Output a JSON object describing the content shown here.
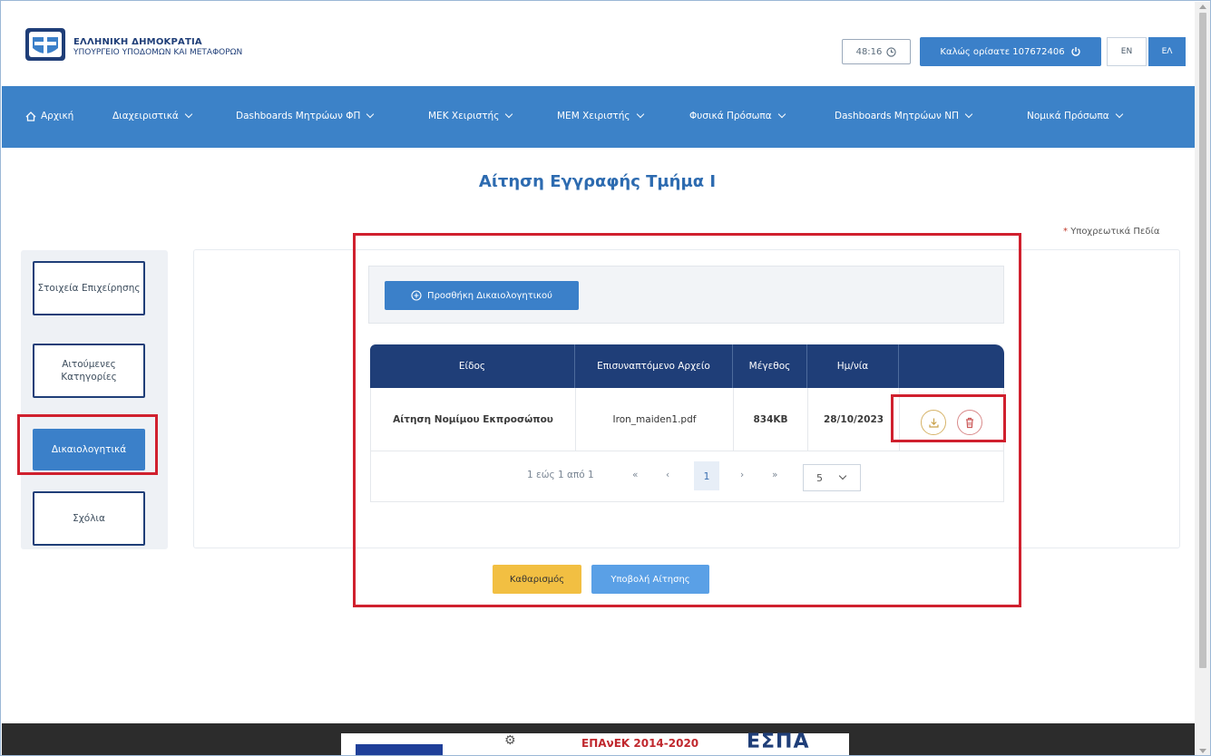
{
  "header": {
    "org_name": "ΕΛΛΗΝΙΚΗ ΔΗΜΟΚΡΑΤΙΑ",
    "org_sub": "ΥΠΟΥΡΓΕΙΟ ΥΠΟΔΟΜΩΝ ΚΑΙ ΜΕΤΑΦΟΡΩΝ",
    "timer": "48:16",
    "welcome": "Καλώς ορίσατε 107672406",
    "lang_en": "EN",
    "lang_el": "ΕΛ"
  },
  "nav": {
    "items": [
      {
        "label": "Αρχική"
      },
      {
        "label": "Διαχειριστικά"
      },
      {
        "label": "Dashboards Μητρώων ΦΠ"
      },
      {
        "label": "ΜΕΚ Χειριστής"
      },
      {
        "label": "ΜΕΜ Χειριστής"
      },
      {
        "label": "Φυσικά Πρόσωπα"
      },
      {
        "label": "Dashboards Μητρώων ΝΠ"
      },
      {
        "label": "Νομικά Πρόσωπα"
      }
    ]
  },
  "page": {
    "title": "Αίτηση Εγγραφής Τμήμα Ι",
    "required_star": "*",
    "required_note": "Υποχρεωτικά Πεδία"
  },
  "sidebar": {
    "steps": [
      {
        "label": "Στοιχεία Επιχείρησης"
      },
      {
        "label": "Αιτούμενες Κατηγορίες"
      },
      {
        "label": "Δικαιολογητικά"
      },
      {
        "label": "Σχόλια"
      }
    ]
  },
  "documents": {
    "add_button": "Προσθήκη Δικαιολογητικού",
    "columns": [
      "Είδος",
      "Επισυναπτόμενο Αρχείο",
      "Μέγεθος",
      "Ημ/νία",
      ""
    ],
    "rows": [
      {
        "type": "Αίτηση Νομίμου Εκπροσώπου",
        "file": "Iron_maiden1.pdf",
        "size": "834KB",
        "date": "28/10/2023"
      }
    ],
    "pagination": {
      "summary": "1 εώς 1 από 1",
      "first": "«",
      "prev": "‹",
      "current": "1",
      "next": "›",
      "last": "»",
      "page_size": "5"
    }
  },
  "actions": {
    "clear": "Καθαρισμός",
    "submit": "Υποβολή Αίτησης"
  },
  "footer": {
    "espa_text": "ΕΠΑνΕΚ 2014-2020",
    "espa_logo": "ΕΣΠΑ"
  },
  "colors": {
    "primary": "#3b80c9",
    "dark_blue": "#1f3e78",
    "highlight_red": "#d0202e",
    "clear_yellow": "#f2bf42"
  }
}
